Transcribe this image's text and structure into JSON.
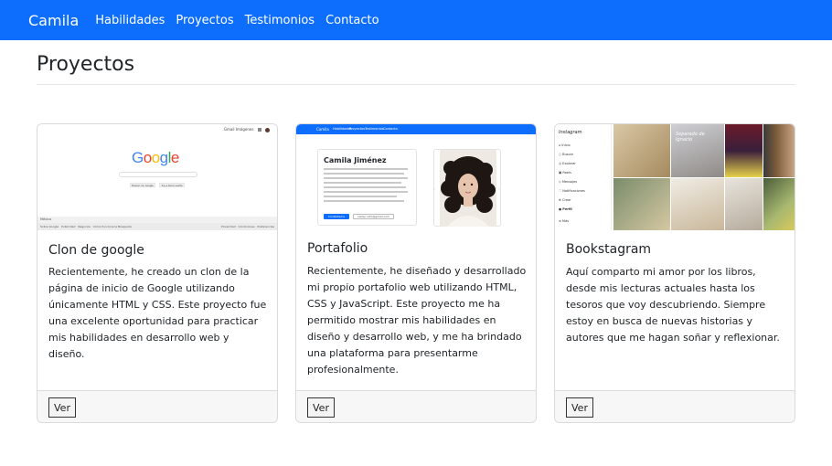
{
  "nav": {
    "brand": "Camila",
    "links": [
      "Habilidades",
      "Proyectos",
      "Testimonios",
      "Contacto"
    ]
  },
  "section": {
    "title": "Proyectos"
  },
  "projects": [
    {
      "title": "Clon de google",
      "text": "Recientemente, he creado un clon de la página de inicio de Google utilizando únicamente HTML y CSS. Este proyecto fue una excelente oportunidad para practicar mis habilidades en desarrollo web y diseño.",
      "button": "Ver",
      "thumb": {
        "top_links": "Gmail  Imágenes",
        "logo": [
          "G",
          "o",
          "o",
          "g",
          "l",
          "e"
        ],
        "logo_colors": [
          "#4285f4",
          "#ea4335",
          "#fbbc05",
          "#4285f4",
          "#34a853",
          "#ea4335"
        ],
        "buttons": [
          "Buscar con Google",
          "Voy a tener suerte"
        ],
        "footer_country": "México",
        "footer_left": "Sobre Google   Publicidad   Negocios   Cómo funciona la Búsqueda",
        "footer_right": "Privacidad   Condiciones   Preferencias"
      }
    },
    {
      "title": "Portafolio",
      "text": "Recientemente, he diseñado y desarrollado mi propio portafolio web utilizando HTML, CSS y JavaScript. Este proyecto me ha permitido mostrar mis habilidades en diseño y desarrollo web, y me ha brindado una plataforma para presentarme profesionalmente.",
      "button": "Ver",
      "thumb": {
        "brand": "Camila",
        "links": [
          "Habilidades",
          "Proyectos",
          "Testimonios",
          "Contacto"
        ],
        "name": "Camila Jiménez",
        "btn1": "Contáctame",
        "btn2": "camijc.info@gmail.com"
      }
    },
    {
      "title": "Bookstagram",
      "text": "Aquí comparto mi amor por los libros, desde mis lecturas actuales hasta los tesoros que voy descubriendo. Siempre estoy en busca de nuevas historias y autores que me hagan soñar y reflexionar.",
      "button": "Ver",
      "thumb": {
        "logo": "Instagram",
        "menu": [
          "Inicio",
          "Buscar",
          "Explorar",
          "Reels",
          "Mensajes",
          "Notificaciones",
          "Crear",
          "Perfil",
          "Más"
        ],
        "overlay": "Separado de Ignacio"
      }
    }
  ],
  "colors": {
    "primary": "#0d6efd",
    "footer_bg": "#f7f7f7"
  }
}
